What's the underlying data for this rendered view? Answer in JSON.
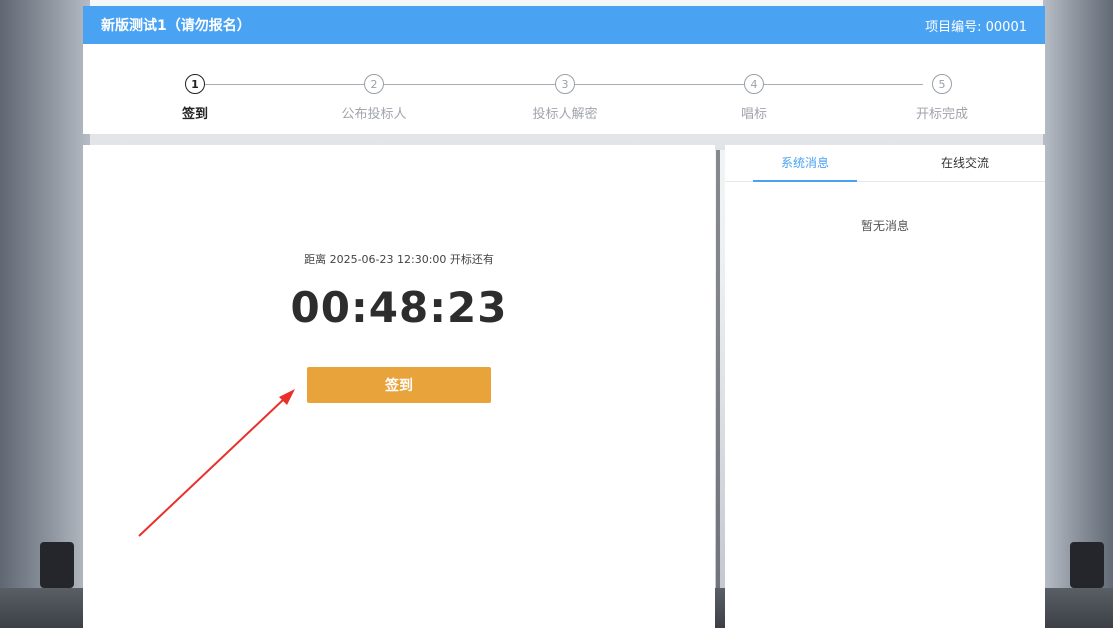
{
  "header": {
    "title": "新版测试1（请勿报名）",
    "project_label": "项目编号: 00001"
  },
  "stepper": {
    "steps": [
      {
        "num": "1",
        "label": "签到"
      },
      {
        "num": "2",
        "label": "公布投标人"
      },
      {
        "num": "3",
        "label": "投标人解密"
      },
      {
        "num": "4",
        "label": "唱标"
      },
      {
        "num": "5",
        "label": "开标完成"
      }
    ],
    "active_step": 1
  },
  "main": {
    "countdown_caption": "距离 2025-06-23 12:30:00 开标还有",
    "countdown": "00:48:23",
    "signin_button": "签到"
  },
  "side": {
    "tabs": [
      {
        "label": "系统消息"
      },
      {
        "label": "在线交流"
      }
    ],
    "active_tab": 0,
    "empty_text": "暂无消息"
  },
  "colors": {
    "header_bg": "#4aa3f2",
    "button_bg": "#e8a33b",
    "tab_active": "#4aa3f2",
    "annotation_arrow": "#e8312a"
  }
}
